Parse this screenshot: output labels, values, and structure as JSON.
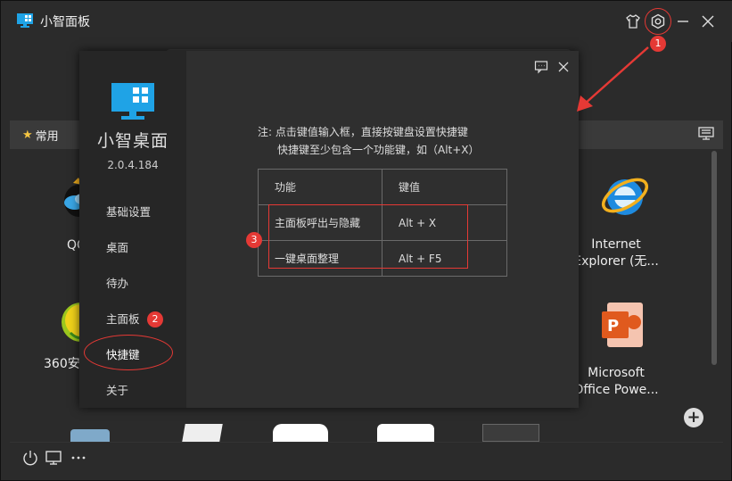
{
  "app": {
    "title": "小智面板"
  },
  "category": {
    "active_tab": "常用"
  },
  "tiles": [
    {
      "label1": "QQ",
      "label2": ""
    },
    {
      "label1": "360安",
      "label2": ""
    },
    {
      "label1": "Internet",
      "label2": "Explorer (无..."
    },
    {
      "label1": "Microsoft",
      "label2": "Office Powe..."
    }
  ],
  "dialog": {
    "app_name": "小智桌面",
    "version": "2.0.4.184",
    "nav": [
      "基础设置",
      "桌面",
      "待办",
      "主面板",
      "快捷键",
      "关于"
    ],
    "note_line1": "注: 点击键值输入框，直接按键盘设置快捷键",
    "note_line2": "快捷键至少包含一个功能键，如（Alt+X）",
    "table": {
      "headers": [
        "功能",
        "键值"
      ],
      "rows": [
        [
          "主面板呼出与隐藏",
          "Alt + X"
        ],
        [
          "一键桌面整理",
          "Alt + F5"
        ]
      ]
    }
  },
  "annotations": [
    "1",
    "2",
    "3"
  ],
  "colors": {
    "accent_red": "#e53935",
    "bg": "#2b2b2b",
    "logo_blue": "#1fa3e6"
  }
}
